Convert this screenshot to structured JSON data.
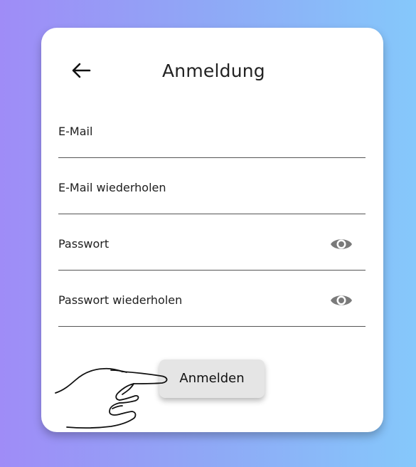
{
  "header": {
    "title": "Anmeldung",
    "back_icon": "arrow-left-icon"
  },
  "form": {
    "fields": [
      {
        "label": "E-Mail",
        "has_visibility_toggle": false
      },
      {
        "label": "E-Mail wiederholen",
        "has_visibility_toggle": false
      },
      {
        "label": "Passwort",
        "has_visibility_toggle": true,
        "toggle_icon": "eye-icon"
      },
      {
        "label": "Passwort wiederholen",
        "has_visibility_toggle": true,
        "toggle_icon": "eye-icon"
      }
    ],
    "submit_label": "Anmelden"
  },
  "overlay": {
    "pointer_icon": "pointing-hand-icon"
  },
  "colors": {
    "background_gradient_start": "#9f8cf7",
    "background_gradient_end": "#85c8fb",
    "card": "#ffffff",
    "button": "#e5e5e5",
    "eye_icon": "#7a7a7a"
  }
}
